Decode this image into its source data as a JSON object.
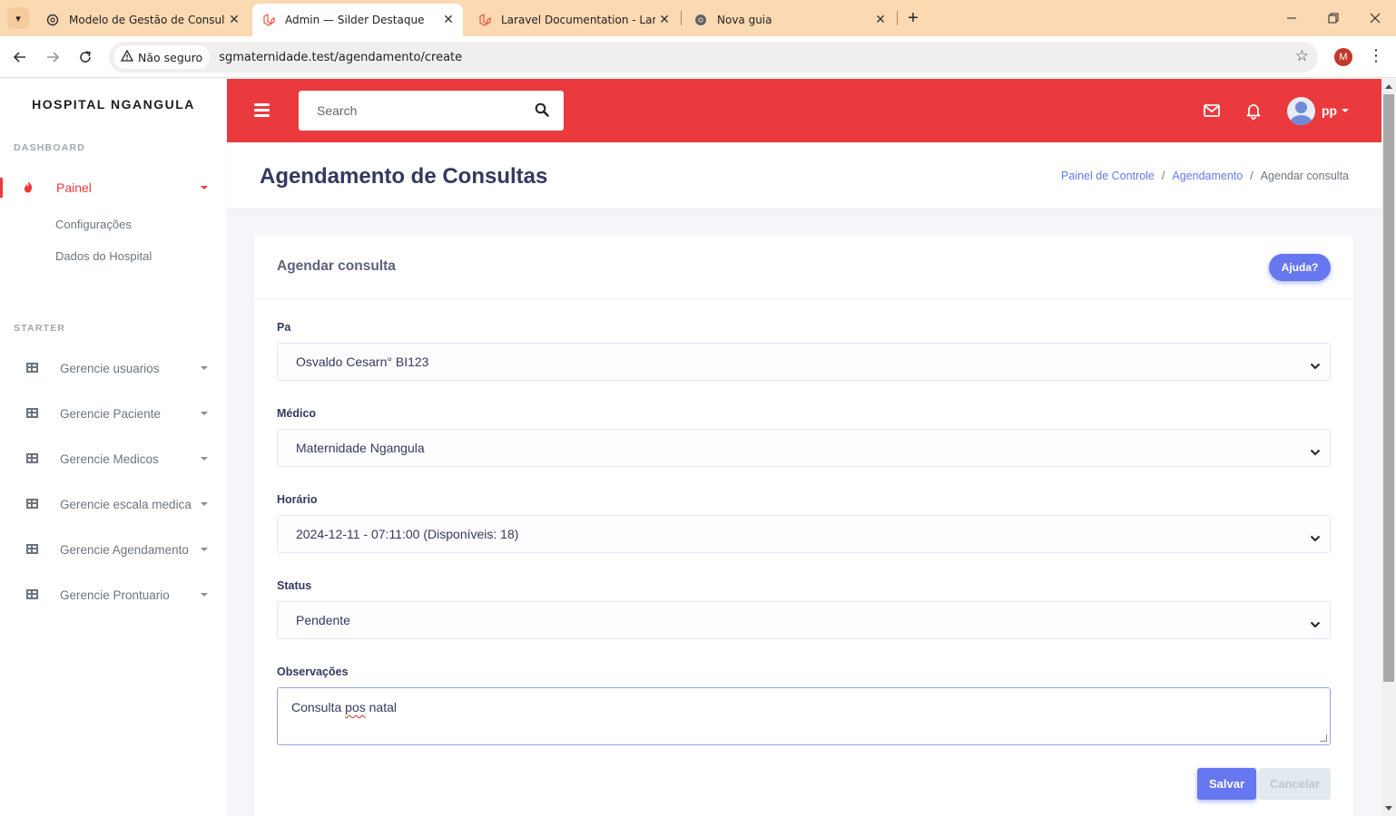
{
  "browser": {
    "tabs": [
      {
        "title": "Modelo de Gestão de Consulta",
        "active": false,
        "icon": "openai-icon"
      },
      {
        "title": "Admin — Silder Destaque",
        "active": true,
        "icon": "laravel-icon"
      },
      {
        "title": "Laravel Documentation - Laravel",
        "active": false,
        "icon": "laravel-icon"
      },
      {
        "title": "Nova guia",
        "active": false,
        "icon": "chrome-icon"
      }
    ],
    "security_label": "Não seguro",
    "url": "sgmaternidade.test/agendamento/create",
    "profile_initial": "M"
  },
  "sidebar": {
    "brand": "HOSPITAL NGANGULA",
    "header_dashboard": "DASHBOARD",
    "painel": "Painel",
    "sub_items": [
      "Configurações",
      "Dados do Hospital"
    ],
    "header_starter": "STARTER",
    "items": [
      "Gerencie usuarios",
      "Gerencie Paciente",
      "Gerencie Medicos",
      "Gerencie escala medica",
      "Gerencie Agendamento",
      "Gerencie Prontuario"
    ]
  },
  "navbar": {
    "search_placeholder": "Search",
    "username": "pp"
  },
  "header": {
    "title": "Agendamento de Consultas",
    "breadcrumb": [
      "Painel de Controle",
      "Agendamento",
      "Agendar consulta"
    ]
  },
  "card": {
    "title": "Agendar consulta",
    "help_button": "Ajuda?",
    "fields": {
      "paciente_label": "Pa",
      "paciente_value": "Osvaldo Cesarn° BI123",
      "medico_label": "Médico",
      "medico_value": "Maternidade Ngangula",
      "horario_label": "Horário",
      "horario_value": "2024-12-11 - 07:11:00 (Disponíveis: 18)",
      "status_label": "Status",
      "status_value": "Pendente",
      "obs_label": "Observações",
      "obs_value_pre": "Consulta ",
      "obs_value_misspelled": "pos",
      "obs_value_post": " natal"
    },
    "save_button": "Salvar",
    "cancel_button": "Cancelar"
  },
  "colors": {
    "brand_red": "#ea3a3d",
    "primary": "#6777ef"
  }
}
